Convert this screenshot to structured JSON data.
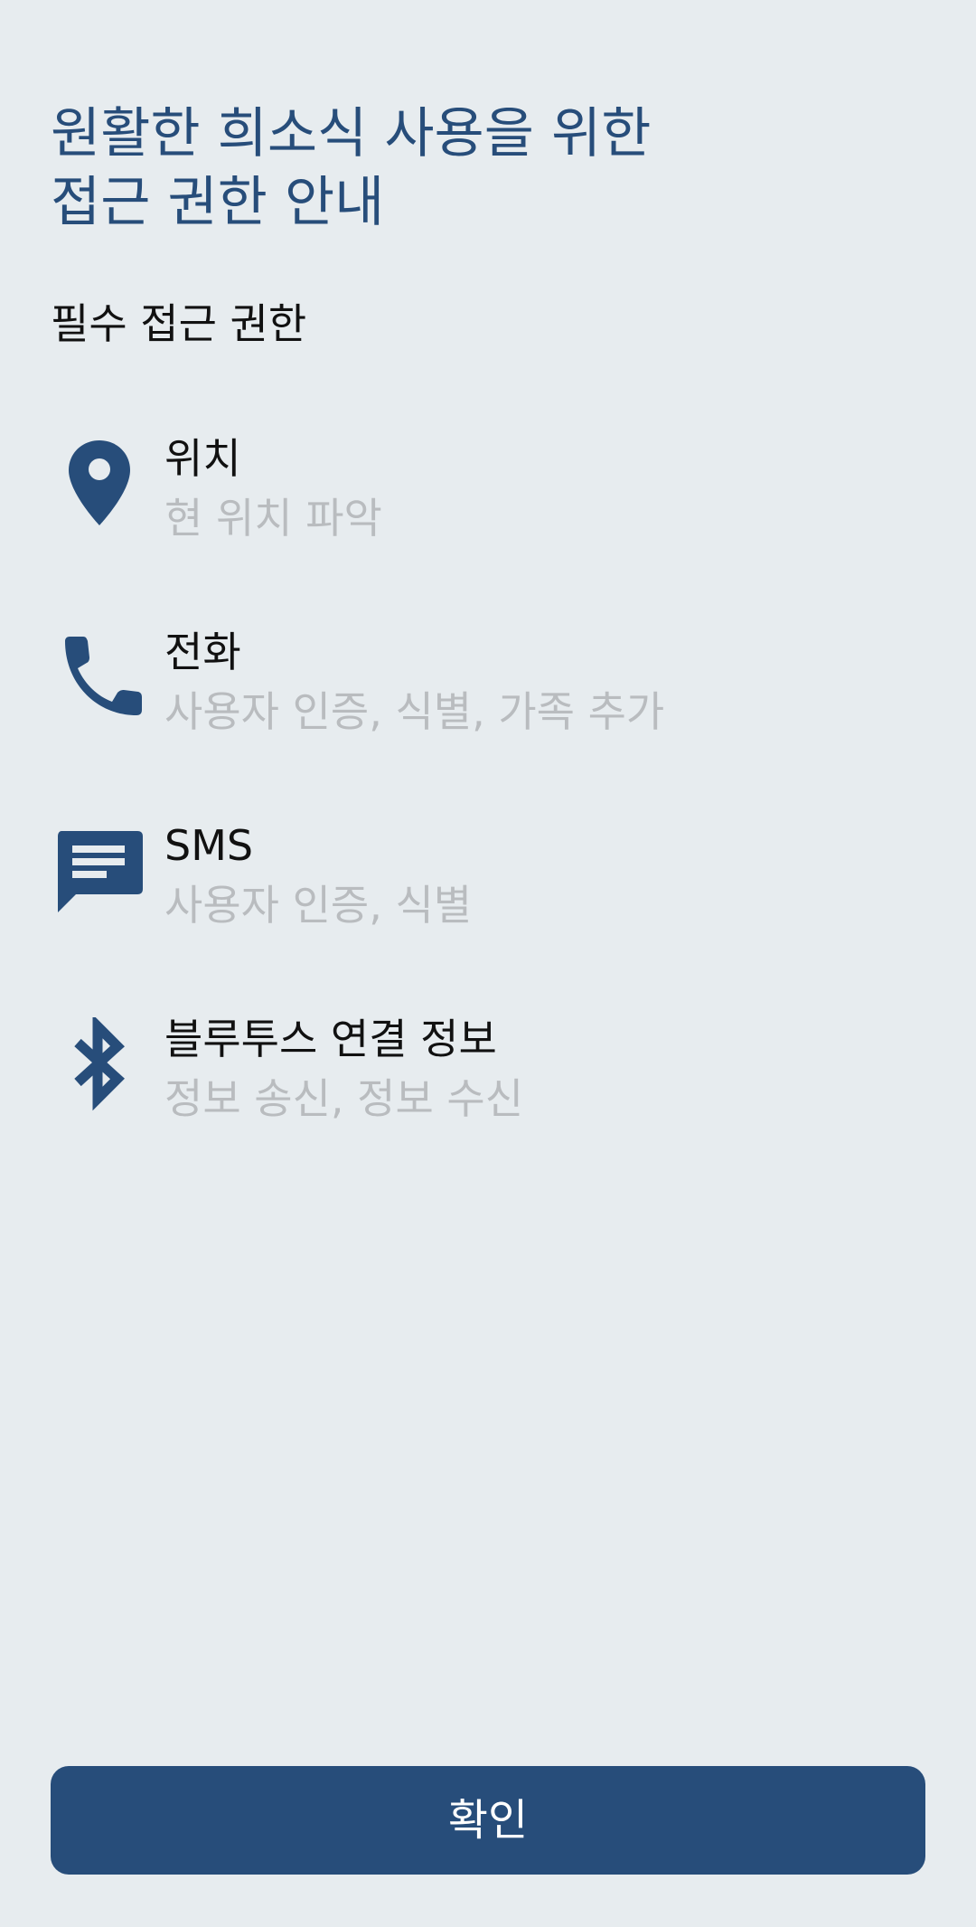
{
  "header": {
    "title_line1": "원활한 희소식 사용을 위한",
    "title_line2": "접근 권한 안내"
  },
  "section": {
    "label": "필수 접근 권한"
  },
  "permissions": [
    {
      "icon": "location-pin-icon",
      "name": "위치",
      "description": "현 위치 파악"
    },
    {
      "icon": "phone-icon",
      "name": "전화",
      "description": "사용자 인증, 식별, 가족 추가"
    },
    {
      "icon": "sms-message-icon",
      "name": "SMS",
      "description": "사용자 인증, 식별"
    },
    {
      "icon": "bluetooth-icon",
      "name": "블루투스 연결 정보",
      "description": "정보 송신, 정보 수신"
    }
  ],
  "footer": {
    "confirm_label": "확인"
  },
  "colors": {
    "background": "#e7ecef",
    "accent": "#274d7a",
    "primary_text": "#111111",
    "secondary_text": "#b9bcbf",
    "button_text": "#ffffff"
  }
}
